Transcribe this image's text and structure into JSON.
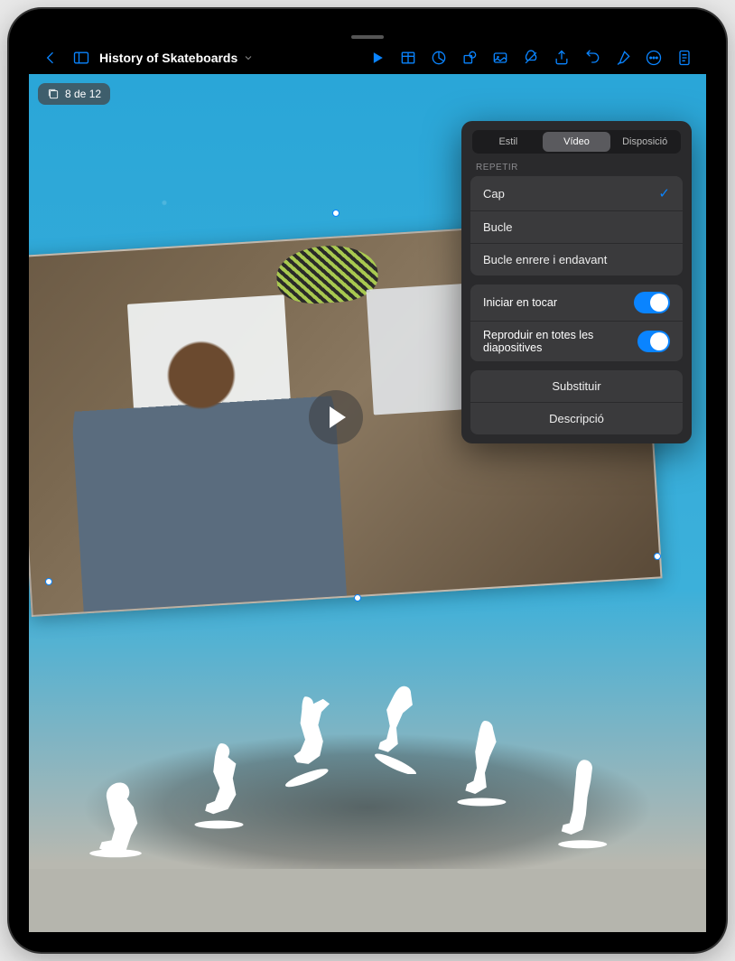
{
  "document": {
    "title": "History of Skateboards"
  },
  "slide": {
    "badge_text": "8 de 12"
  },
  "toolbar": {
    "icons": {
      "back": "back-chevron-icon",
      "sidebar": "sidebar-icon",
      "play": "play-icon",
      "table": "table-icon",
      "chart": "chart-icon",
      "shape": "shape-icon",
      "media": "media-icon",
      "cloud": "collab-icon",
      "share": "share-icon",
      "undo": "undo-icon",
      "format": "format-brush-icon",
      "more": "more-icon",
      "doc": "document-options-icon"
    }
  },
  "popover": {
    "tabs": {
      "style": "Estil",
      "video": "Vídeo",
      "layout": "Disposició"
    },
    "section_repeat": "REPETIR",
    "repeat_options": {
      "none": "Cap",
      "loop": "Bucle",
      "loop_bf": "Bucle enrere i endavant"
    },
    "toggles": {
      "start_on_tap": "Iniciar en tocar",
      "play_all": "Reproduir en totes les diapositives"
    },
    "actions": {
      "replace": "Substituir",
      "description": "Descripció"
    }
  }
}
